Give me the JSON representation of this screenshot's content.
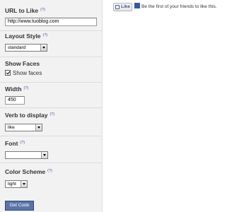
{
  "form": {
    "url": {
      "label": "URL to Like",
      "help": "(?)",
      "value": "http://www.tuoblog.com"
    },
    "layout": {
      "label": "Layout Style",
      "help": "(?)",
      "selected": "standard"
    },
    "faces": {
      "label": "Show Faces",
      "checkbox_label": "Show faces",
      "checked": true
    },
    "width": {
      "label": "Width",
      "help": "(?)",
      "value": "450"
    },
    "verb": {
      "label": "Verb to display",
      "help": "(?)",
      "selected": "like"
    },
    "font": {
      "label": "Font",
      "help": "(?)",
      "selected": ""
    },
    "color": {
      "label": "Color Scheme",
      "help": "(?)",
      "selected": "light"
    },
    "submit_label": "Get Code"
  },
  "preview": {
    "like_label": "Like",
    "social_text": "Be the first of your friends to like this."
  },
  "colors": {
    "accent": "#3b5998",
    "button": "#5b74a8",
    "sidebar": "#f2f2f2"
  }
}
